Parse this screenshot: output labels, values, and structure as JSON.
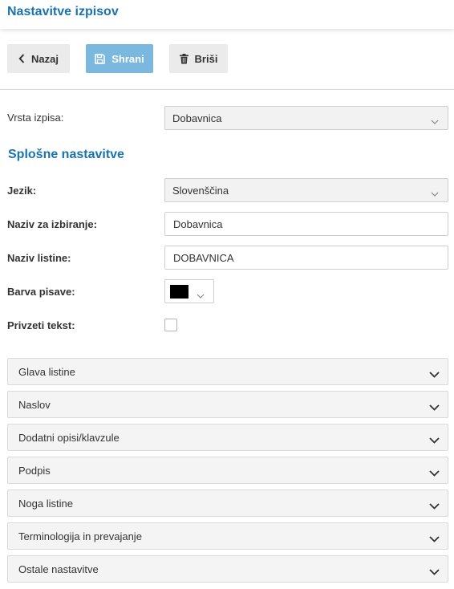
{
  "header": {
    "title": "Nastavitve izpisov"
  },
  "toolbar": {
    "back_label": "Nazaj",
    "save_label": "Shrani",
    "delete_label": "Briši"
  },
  "form": {
    "report_type": {
      "label": "Vrsta izpisa:",
      "value": "Dobavnica"
    },
    "section_title": "Splošne nastavitve",
    "language": {
      "label": "Jezik:",
      "value": "Slovenščina"
    },
    "selection_name": {
      "label": "Naziv za izbiranje:",
      "value": "Dobavnica"
    },
    "document_name": {
      "label": "Naziv listine:",
      "value": "DOBAVNICA"
    },
    "font_color": {
      "label": "Barva pisave:",
      "color": "#000000"
    },
    "take_text": {
      "label": "Privzeti tekst:",
      "checked": false
    }
  },
  "panels": [
    {
      "title": "Glava listine"
    },
    {
      "title": "Naslov"
    },
    {
      "title": "Dodatni opisi/klavzule"
    },
    {
      "title": "Podpis"
    },
    {
      "title": "Noga listine"
    },
    {
      "title": "Terminologija in prevajanje"
    },
    {
      "title": "Ostale nastavitve"
    }
  ],
  "colors": {
    "accent": "#1a73b0",
    "save_button": "#7ab8e0",
    "button_bg": "#ebebeb",
    "panel_bg": "#f4f4f4"
  },
  "icons": {
    "back": "chevron-left-icon",
    "save": "floppy-disk-icon",
    "delete": "trash-icon",
    "select": "chevron-down-icon",
    "panel": "chevron-down-icon"
  }
}
